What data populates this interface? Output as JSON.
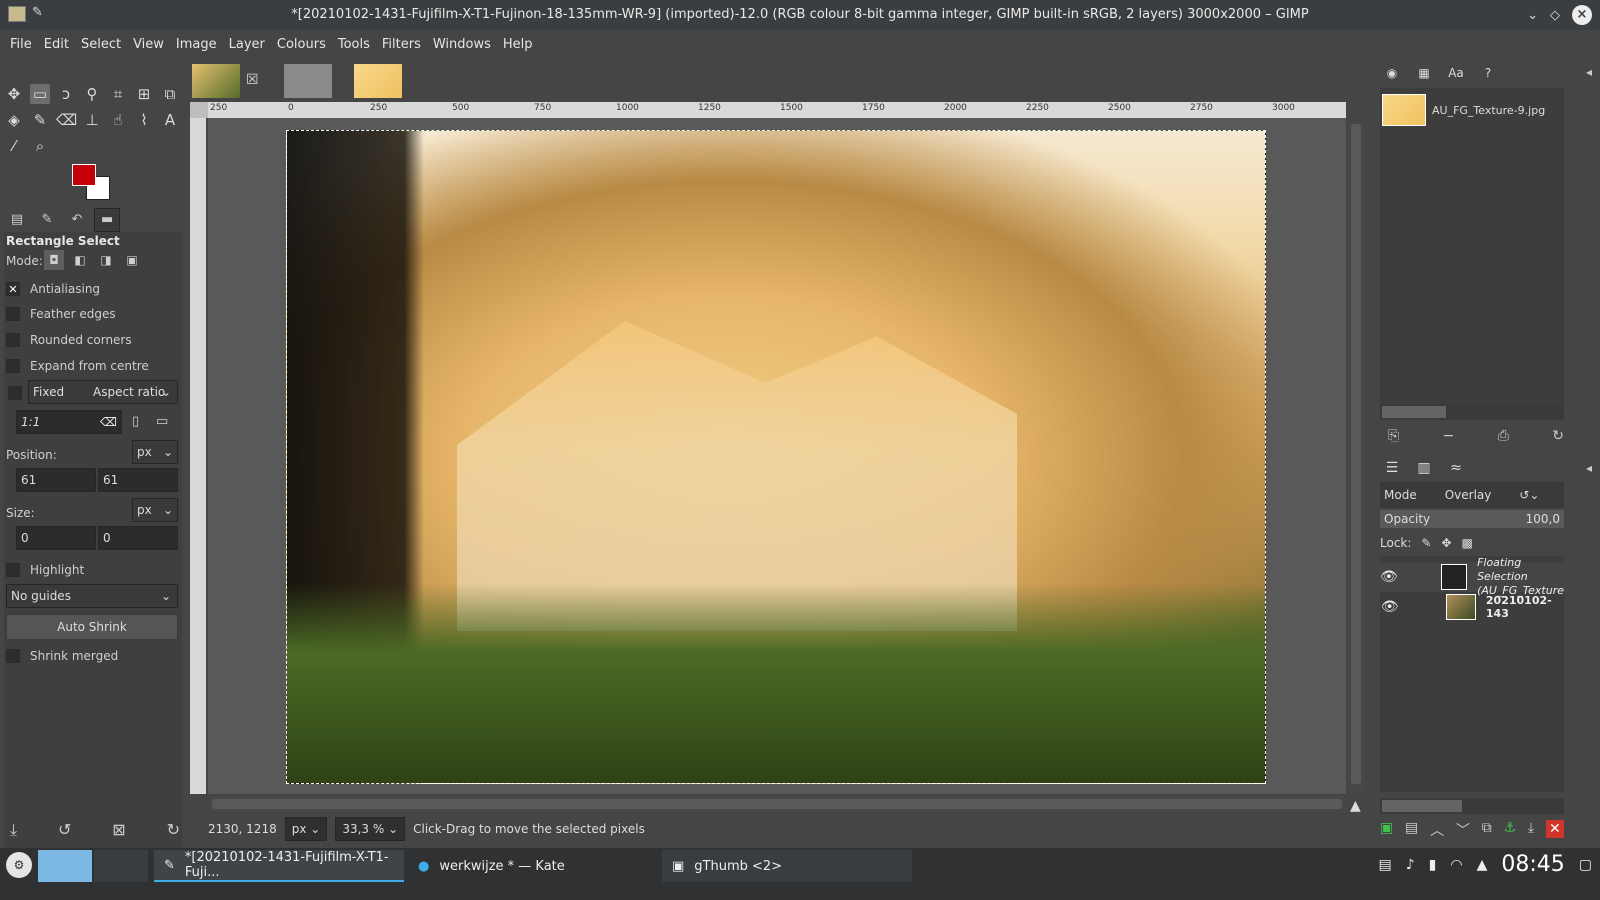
{
  "window": {
    "title": "*[20210102-1431-Fujifilm-X-T1-Fujinon-18-135mm-WR-9] (imported)-12.0 (RGB colour 8-bit gamma integer, GIMP built-in sRGB, 2 layers) 3000x2000 – GIMP"
  },
  "menu": [
    "File",
    "Edit",
    "Select",
    "View",
    "Image",
    "Layer",
    "Colours",
    "Tools",
    "Filters",
    "Windows",
    "Help"
  ],
  "tool_options": {
    "title": "Rectangle Select",
    "mode_label": "Mode:",
    "antialiasing": {
      "label": "Antialiasing",
      "checked": "✕"
    },
    "feather_edges": "Feather edges",
    "rounded_corners": "Rounded corners",
    "expand_from_centre": "Expand from centre",
    "fixed_label": "Fixed",
    "fixed_value": "Aspect ratio",
    "ratio_value": "1:1",
    "position_label": "Position:",
    "position_unit": "px",
    "position_x": "61",
    "position_y": "61",
    "size_label": "Size:",
    "size_unit": "px",
    "size_w": "0",
    "size_h": "0",
    "highlight": "Highlight",
    "guides": "No guides",
    "auto_shrink": "Auto Shrink",
    "shrink_merged": "Shrink merged"
  },
  "colors": {
    "foreground": "#c4000a",
    "background": "#ffffff"
  },
  "ruler": {
    "h_ticks": [
      "250",
      "0",
      "250",
      "500",
      "750",
      "1000",
      "1250",
      "1500",
      "1750",
      "2000",
      "2250",
      "2500",
      "2750",
      "3000"
    ]
  },
  "status": {
    "coords": "2130, 1218",
    "unit": "px",
    "zoom": "33,3 %",
    "message": "Click-Drag to move the selected pixels"
  },
  "patterns": {
    "selected_name": "AU_FG_Texture-9.jpg"
  },
  "layers": {
    "mode_label": "Mode",
    "mode_value": "Overlay",
    "opacity_label": "Opacity",
    "opacity_value": "100,0",
    "lock_label": "Lock:",
    "items": [
      {
        "name": "Floating Selection",
        "name2": "(AU_FG_Texture"
      },
      {
        "name": "20210102-143"
      }
    ]
  },
  "taskbar": {
    "tasks": [
      {
        "label": "*[20210102-1431-Fujifilm-X-T1-Fuji..."
      },
      {
        "label": "werkwijze * — Kate"
      },
      {
        "label": "gThumb <2>"
      }
    ],
    "clock": "08:45"
  }
}
